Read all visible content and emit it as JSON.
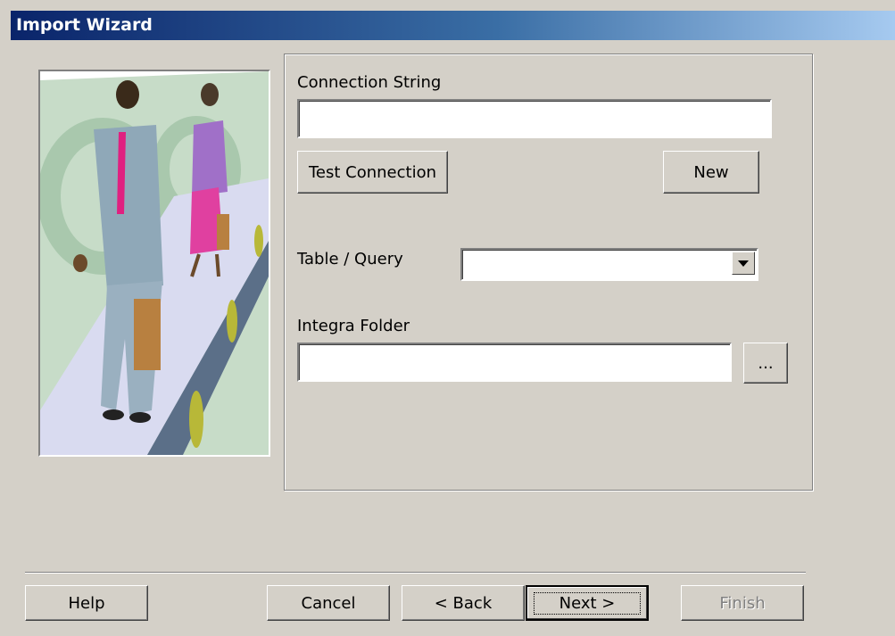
{
  "window": {
    "title": "Import Wizard"
  },
  "illustration": {
    "icon": "business-people-clipart"
  },
  "form": {
    "connection_string": {
      "label": "Connection String",
      "value": ""
    },
    "test_connection_label": "Test Connection",
    "new_label": "New",
    "table_query": {
      "label": "Table / Query",
      "selected": ""
    },
    "integra_folder": {
      "label": "Integra Folder",
      "value": ""
    },
    "browse_label": "..."
  },
  "footer": {
    "help_label": "Help",
    "cancel_label": "Cancel",
    "back_label": "< Back",
    "next_label": "Next >",
    "finish_label": "Finish"
  }
}
